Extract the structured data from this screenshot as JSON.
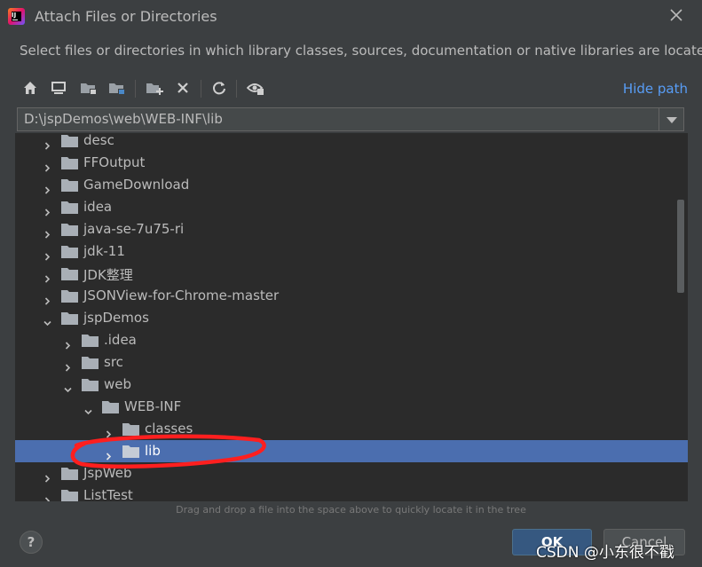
{
  "window": {
    "title": "Attach Files or Directories",
    "subtitle": "Select files or directories in which library classes, sources, documentation or native libraries are located"
  },
  "toolbar": {
    "buttons": [
      "home-icon",
      "desktop-icon",
      "project-folder-icon",
      "module-folder-icon",
      "new-folder-icon",
      "delete-icon",
      "refresh-icon",
      "show-hidden-icon"
    ],
    "hide_path_label": "Hide path"
  },
  "path": {
    "value": "D:\\jspDemos\\web\\WEB-INF\\lib"
  },
  "tree": {
    "items": [
      {
        "label": "desc",
        "level": 0,
        "expanded": false,
        "selected": false
      },
      {
        "label": "FFOutput",
        "level": 0,
        "expanded": false,
        "selected": false
      },
      {
        "label": "GameDownload",
        "level": 0,
        "expanded": false,
        "selected": false
      },
      {
        "label": "idea",
        "level": 0,
        "expanded": false,
        "selected": false
      },
      {
        "label": "java-se-7u75-ri",
        "level": 0,
        "expanded": false,
        "selected": false
      },
      {
        "label": "jdk-11",
        "level": 0,
        "expanded": false,
        "selected": false
      },
      {
        "label": "JDK整理",
        "level": 0,
        "expanded": false,
        "selected": false
      },
      {
        "label": "JSONView-for-Chrome-master",
        "level": 0,
        "expanded": false,
        "selected": false
      },
      {
        "label": "jspDemos",
        "level": 0,
        "expanded": true,
        "selected": false
      },
      {
        "label": ".idea",
        "level": 1,
        "expanded": false,
        "selected": false
      },
      {
        "label": "src",
        "level": 1,
        "expanded": false,
        "selected": false
      },
      {
        "label": "web",
        "level": 1,
        "expanded": true,
        "selected": false
      },
      {
        "label": "WEB-INF",
        "level": 2,
        "expanded": true,
        "selected": false
      },
      {
        "label": "classes",
        "level": 3,
        "expanded": false,
        "selected": false
      },
      {
        "label": "lib",
        "level": 3,
        "expanded": false,
        "selected": true
      },
      {
        "label": "JspWeb",
        "level": 0,
        "expanded": false,
        "selected": false
      },
      {
        "label": "ListTest",
        "level": 0,
        "expanded": false,
        "selected": false
      }
    ],
    "hint": "Drag and drop a file into the space above to quickly locate it in the tree"
  },
  "footer": {
    "help_label": "?",
    "ok_label": "OK",
    "cancel_label": "Cancel",
    "watermark": "CSDN @小东很不戳"
  },
  "colors": {
    "background": "#3c3f41",
    "tree_background": "#2b2b2b",
    "selection": "#4b6eaf",
    "link": "#589df6",
    "annotation": "#ff1f1f"
  }
}
